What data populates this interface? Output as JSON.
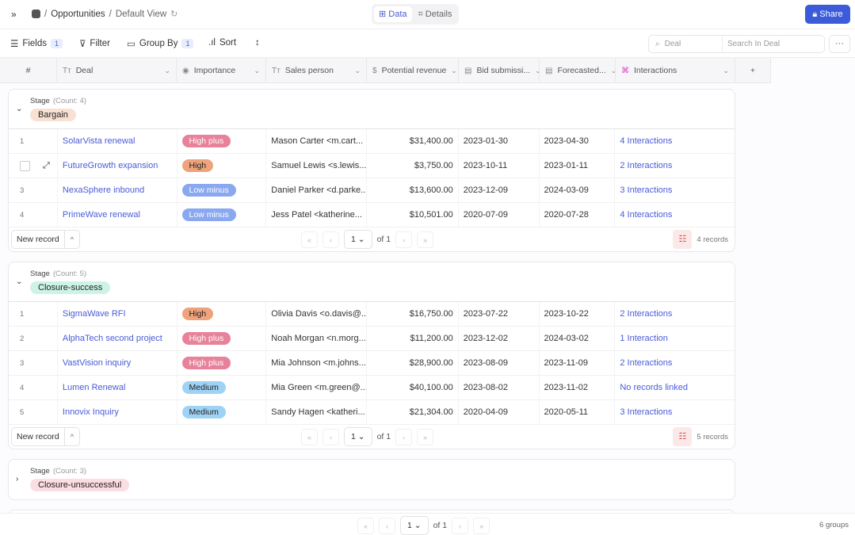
{
  "topbar": {
    "expand_icon": "double-chevron-right",
    "breadcrumb": {
      "sep": "/",
      "base": "Opportunities",
      "view": "Default View"
    },
    "tabs": [
      {
        "label": "Data",
        "icon": "grid-icon",
        "active": true
      },
      {
        "label": "Details",
        "icon": "details-icon",
        "active": false
      }
    ],
    "share_label": "Share"
  },
  "toolbar": {
    "fields_label": "Fields",
    "fields_count": "1",
    "filter_label": "Filter",
    "groupby_label": "Group By",
    "groupby_count": "1",
    "sort_label": "Sort",
    "search_field": "Deal",
    "search_placeholder": "Search In Deal",
    "more_label": "···"
  },
  "columns": [
    {
      "label": "#",
      "icon": ""
    },
    {
      "label": "Deal",
      "icon": "Tт"
    },
    {
      "label": "Importance",
      "icon": "◉"
    },
    {
      "label": "Sales person",
      "icon": "Tт"
    },
    {
      "label": "Potential revenue",
      "icon": "$"
    },
    {
      "label": "Bid submissi...",
      "icon": "▤"
    },
    {
      "label": "Forecasted...",
      "icon": "▤"
    },
    {
      "label": "Interactions",
      "icon": "⌘"
    }
  ],
  "add_column_label": "+",
  "importance_colors": {
    "High plus": "#e8829a",
    "High": "#eea37c",
    "Low minus": "#8aa8f0",
    "Medium": "#9fd3f5"
  },
  "groups": [
    {
      "field": "Stage",
      "count": "(Count: 4)",
      "value": "Bargain",
      "color": "#f8e1d2",
      "expanded": true,
      "records_label": "4 records",
      "page": "1",
      "of": "of 1",
      "new_record": "New record",
      "rows": [
        {
          "n": "1",
          "deal": "SolarVista renewal",
          "importance": "High plus",
          "sales": "Mason Carter <m.cart...",
          "revenue": "$31,400.00",
          "bid": "2023-01-30",
          "forecast": "2023-04-30",
          "interactions": "4 Interactions"
        },
        {
          "n": "2",
          "deal": "FutureGrowth expansion",
          "importance": "High",
          "sales": "Samuel Lewis <s.lewis...",
          "revenue": "$3,750.00",
          "bid": "2023-10-11",
          "forecast": "2023-01-11",
          "interactions": "2 Interactions",
          "hover": true
        },
        {
          "n": "3",
          "deal": "NexaSphere inbound",
          "importance": "Low minus",
          "sales": "Daniel Parker <d.parke...",
          "revenue": "$13,600.00",
          "bid": "2023-12-09",
          "forecast": "2024-03-09",
          "interactions": "3 Interactions"
        },
        {
          "n": "4",
          "deal": "PrimeWave renewal",
          "importance": "Low minus",
          "sales": "Jess Patel <katherine...",
          "revenue": "$10,501.00",
          "bid": "2020-07-09",
          "forecast": "2020-07-28",
          "interactions": "4 Interactions"
        }
      ]
    },
    {
      "field": "Stage",
      "count": "(Count: 5)",
      "value": "Closure-success",
      "color": "#cdf3e6",
      "expanded": true,
      "records_label": "5 records",
      "page": "1",
      "of": "of 1",
      "new_record": "New record",
      "rows": [
        {
          "n": "1",
          "deal": "SigmaWave RFI",
          "importance": "High",
          "sales": "Olivia Davis <o.davis@...",
          "revenue": "$16,750.00",
          "bid": "2023-07-22",
          "forecast": "2023-10-22",
          "interactions": "2 Interactions"
        },
        {
          "n": "2",
          "deal": "AlphaTech second project",
          "importance": "High plus",
          "sales": "Noah Morgan <n.morg...",
          "revenue": "$11,200.00",
          "bid": "2023-12-02",
          "forecast": "2024-03-02",
          "interactions": "1 Interaction"
        },
        {
          "n": "3",
          "deal": "VastVision inquiry",
          "importance": "High plus",
          "sales": "Mia Johnson <m.johns...",
          "revenue": "$28,900.00",
          "bid": "2023-08-09",
          "forecast": "2023-11-09",
          "interactions": "2 Interactions"
        },
        {
          "n": "4",
          "deal": "Lumen Renewal",
          "importance": "Medium",
          "sales": "Mia Green <m.green@...",
          "revenue": "$40,100.00",
          "bid": "2023-08-02",
          "forecast": "2023-11-02",
          "interactions": "No records linked"
        },
        {
          "n": "5",
          "deal": "Innovix Inquiry",
          "importance": "Medium",
          "sales": "Sandy Hagen <katheri...",
          "revenue": "$21,304.00",
          "bid": "2020-04-09",
          "forecast": "2020-05-11",
          "interactions": "3 Interactions"
        }
      ]
    },
    {
      "field": "Stage",
      "count": "(Count: 3)",
      "value": "Closure-unsuccessful",
      "color": "#fbdde3",
      "expanded": false,
      "rows": []
    }
  ],
  "footer": {
    "page": "1",
    "of": "of 1",
    "groups_label": "6 groups"
  }
}
